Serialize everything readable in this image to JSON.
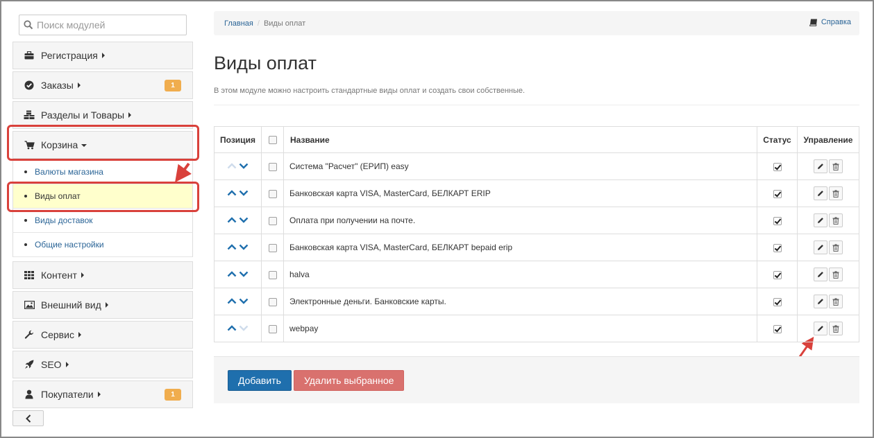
{
  "search": {
    "placeholder": "Поиск модулей"
  },
  "sidebar": {
    "items": [
      {
        "label": "Регистрация",
        "icon": "briefcase-icon"
      },
      {
        "label": "Заказы",
        "icon": "check-circle-icon",
        "badge": "1"
      },
      {
        "label": "Разделы и Товары",
        "icon": "cubes-icon"
      },
      {
        "label": "Корзина",
        "icon": "cart-icon",
        "expanded": true
      },
      {
        "label": "Контент",
        "icon": "grid-icon"
      },
      {
        "label": "Внешний вид",
        "icon": "image-icon"
      },
      {
        "label": "Сервис",
        "icon": "wrench-icon"
      },
      {
        "label": "SEO",
        "icon": "rocket-icon"
      },
      {
        "label": "Покупатели",
        "icon": "user-icon",
        "badge": "1"
      }
    ],
    "subitems": [
      {
        "label": "Валюты магазина"
      },
      {
        "label": "Виды оплат",
        "active": true
      },
      {
        "label": "Виды доставок"
      },
      {
        "label": "Общие настройки"
      }
    ]
  },
  "breadcrumb": {
    "home": "Главная",
    "separator": "/",
    "current": "Виды оплат"
  },
  "help": {
    "label": "Справка"
  },
  "page": {
    "title": "Виды оплат",
    "description": "В этом модуле можно настроить стандартные виды оплат и создать свои собственные."
  },
  "table": {
    "headers": {
      "position": "Позиция",
      "name": "Название",
      "status": "Статус",
      "control": "Управление"
    },
    "rows": [
      {
        "name": "Система \"Расчет\" (ЕРИП) easy",
        "status": true,
        "up_enabled": false,
        "down_enabled": true
      },
      {
        "name": "Банковская карта VISA, MasterCard, БЕЛКАРТ ERIP",
        "status": true,
        "up_enabled": true,
        "down_enabled": true
      },
      {
        "name": "Оплата при получении на почте.",
        "status": true,
        "up_enabled": true,
        "down_enabled": true
      },
      {
        "name": "Банковская карта VISA, MasterCard, БЕЛКАРТ bepaid erip",
        "status": true,
        "up_enabled": true,
        "down_enabled": true
      },
      {
        "name": "halva",
        "status": true,
        "up_enabled": true,
        "down_enabled": true
      },
      {
        "name": "Электронные деньги. Банковские карты.",
        "status": true,
        "up_enabled": true,
        "down_enabled": true
      },
      {
        "name": "webpay",
        "status": true,
        "up_enabled": true,
        "down_enabled": false
      }
    ]
  },
  "buttons": {
    "add": "Добавить",
    "delete_selected": "Удалить выбранное"
  },
  "colors": {
    "accent": "#1f6fad",
    "danger": "#d9716e",
    "badge": "#f0ad4e",
    "highlight": "#d9413b",
    "link": "#2a6496"
  }
}
